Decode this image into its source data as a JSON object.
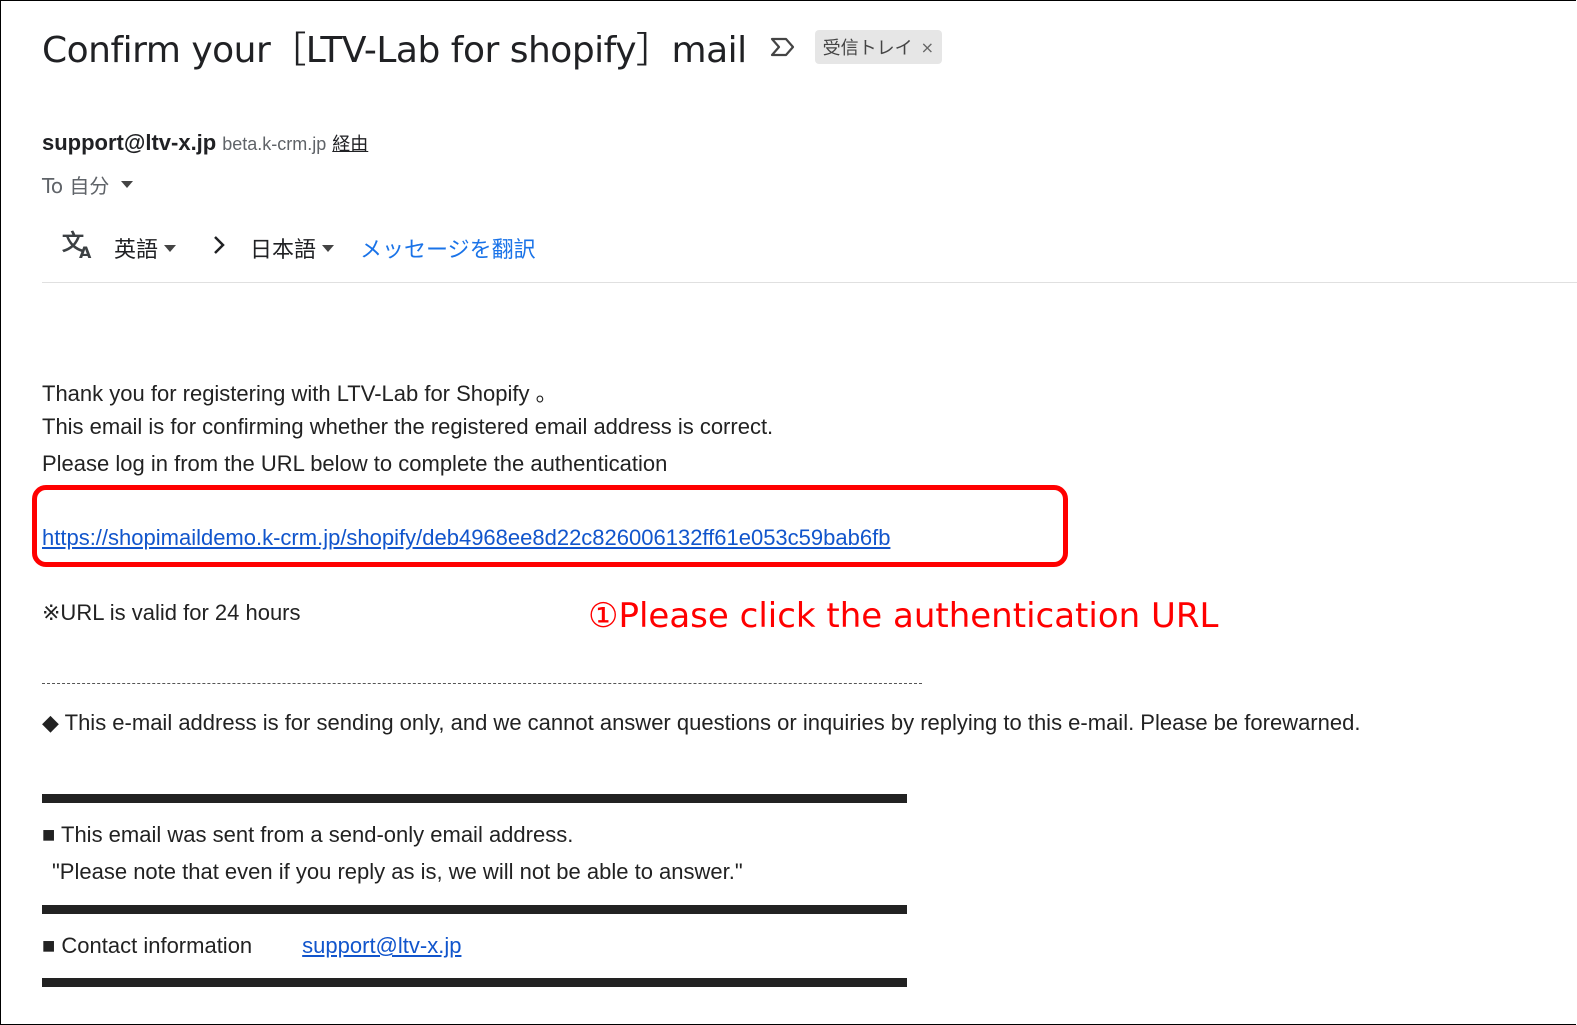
{
  "email": {
    "subject": "Confirm your［LTV-Lab for shopify］mail",
    "label": "受信トレイ",
    "label_close": "×",
    "sender_email": "support@ltv-x.jp",
    "sender_via_domain": "beta.k-crm.jp",
    "sender_via_label": "経由",
    "to_line": "To 自分"
  },
  "translate_bar": {
    "source_lang": "英語",
    "target_lang": "日本語",
    "translate_link": "メッセージを翻訳"
  },
  "body": {
    "line1": "Thank you for registering with LTV-Lab for Shopify 。",
    "line2": "This email is for confirming whether the registered email address is correct.",
    "line3": "Please log in from the URL below to complete the authentication",
    "auth_url": "https://shopimaildemo.k-crm.jp/shopify/deb4968ee8d22c826006132ff61e053c59bab6fb",
    "validity_note": "※URL is valid for 24 hours",
    "send_only_notice": "◆ This e-mail address is for sending only, and we cannot answer questions or inquiries by replying to this e-mail. Please be forewarned.",
    "sent_from_note": "■ This email was sent from a send-only email address.",
    "reply_note": "\"Please note that even if you reply as is, we will not be able to answer.\"",
    "contact_label": "■ Contact information",
    "contact_email": "support@ltv-x.jp"
  },
  "annotation": {
    "text": "①Please click the authentication URL",
    "color": "#ff0000"
  },
  "icons": {
    "translate": "translate-icon",
    "importance": "importance-marker-icon",
    "arrow": "chevron-right-icon"
  }
}
